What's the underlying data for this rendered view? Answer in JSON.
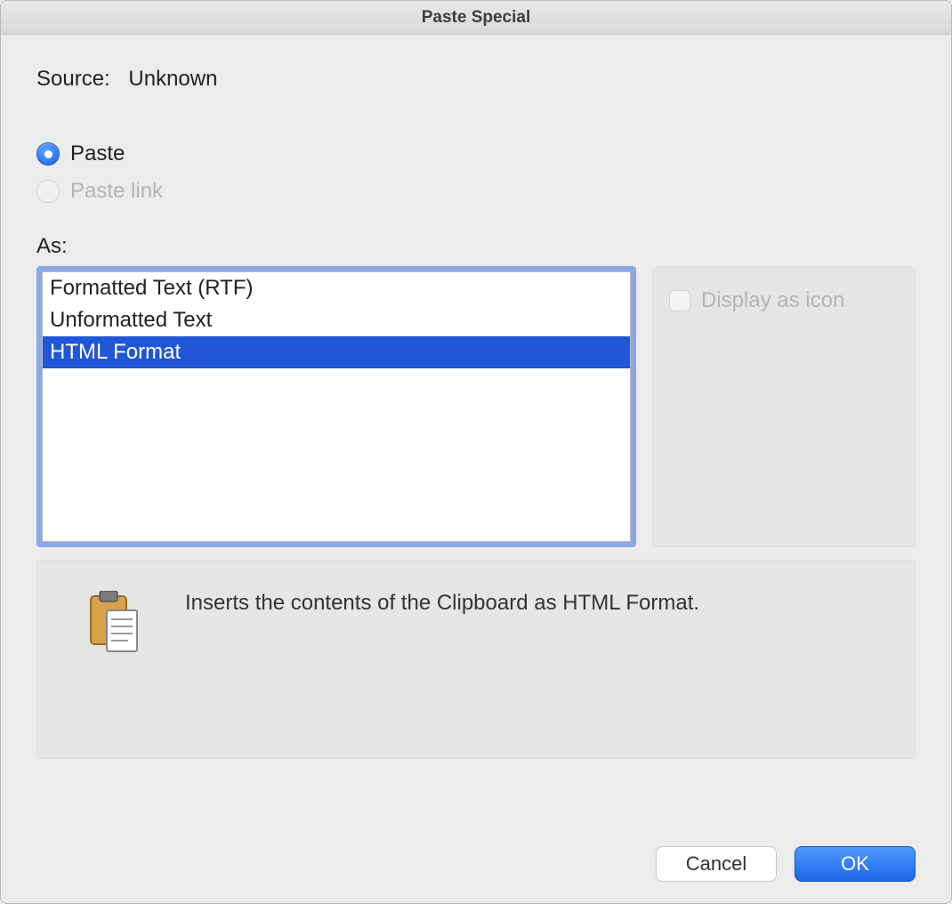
{
  "title": "Paste Special",
  "source": {
    "label": "Source:",
    "value": "Unknown"
  },
  "radios": {
    "paste": {
      "label": "Paste",
      "checked": true,
      "disabled": false
    },
    "paste_link": {
      "label": "Paste link",
      "checked": false,
      "disabled": true
    }
  },
  "as_label": "As:",
  "formats": [
    {
      "label": "Formatted Text (RTF)",
      "selected": false
    },
    {
      "label": "Unformatted Text",
      "selected": false
    },
    {
      "label": "HTML Format",
      "selected": true
    }
  ],
  "display_as_icon": {
    "label": "Display as icon",
    "checked": false,
    "disabled": true
  },
  "description": "Inserts the contents of the Clipboard as HTML Format.",
  "buttons": {
    "cancel": "Cancel",
    "ok": "OK"
  }
}
